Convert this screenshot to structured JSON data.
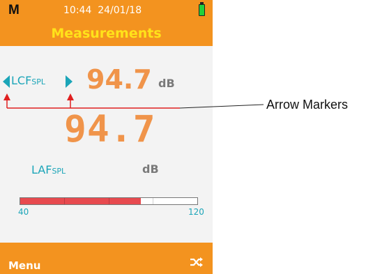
{
  "status_bar": {
    "mode": "M",
    "time_date": "10:44  24/01/18",
    "battery_icon": "battery-full-icon",
    "battery_color": "#23d13a"
  },
  "header": {
    "title": "Measurements",
    "title_color": "#ffe21a",
    "background": "#f3931f"
  },
  "primary_measurement": {
    "parameter": "LCF",
    "parameter_sub": "SPL",
    "value": "94.7",
    "unit": "dB",
    "prev_icon": "triangle-left-icon",
    "next_icon": "triangle-right-icon"
  },
  "secondary_measurement": {
    "value": "94.7",
    "parameter": "LAF",
    "parameter_sub": "SPL",
    "unit": "dB"
  },
  "level_bar": {
    "min_label": "40",
    "max_label": "120",
    "level_fraction": 0.68,
    "fill_color": "#e74a4f"
  },
  "footer": {
    "menu_label": "Menu",
    "shuffle_icon": "shuffle-icon"
  },
  "annotation": {
    "label": "Arrow Markers",
    "color": "#e02020"
  },
  "colors": {
    "accent_teal": "#1ba5b8",
    "value_orange": "#f0944a",
    "unit_gray": "#7a7a7a"
  }
}
